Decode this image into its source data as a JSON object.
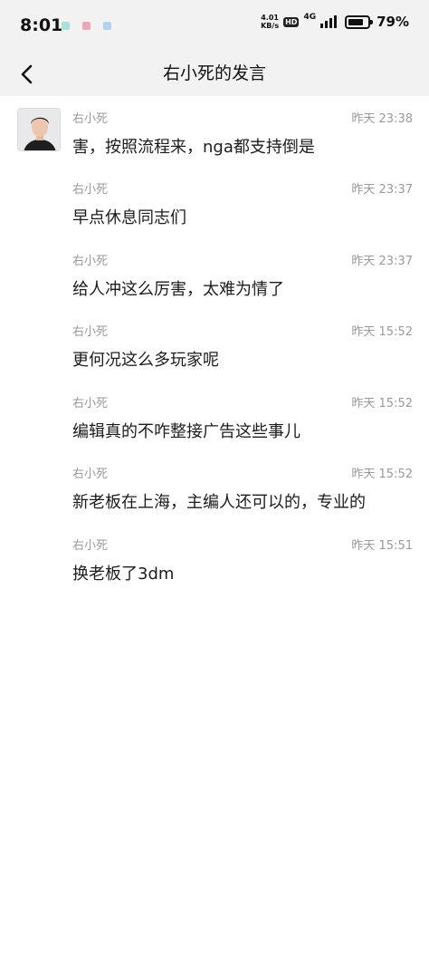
{
  "status_bar": {
    "time": "8:01",
    "net_speed_value": "4.01",
    "net_speed_unit": "KB/s",
    "hd_label": "HD",
    "network_type": "4G",
    "battery_percent": "79%",
    "battery_level": 0.79
  },
  "header": {
    "title": "右小死的发言"
  },
  "posts": [
    {
      "author": "右小死",
      "time": "昨天 23:38",
      "text": "害，按照流程来，nga都支持倒是"
    },
    {
      "author": "右小死",
      "time": "昨天 23:37",
      "text": "早点休息同志们"
    },
    {
      "author": "右小死",
      "time": "昨天 23:37",
      "text": "给人冲这么厉害，太难为情了"
    },
    {
      "author": "右小死",
      "time": "昨天 15:52",
      "text": "更何况这么多玩家呢"
    },
    {
      "author": "右小死",
      "time": "昨天 15:52",
      "text": "编辑真的不咋整接广告这些事儿"
    },
    {
      "author": "右小死",
      "time": "昨天 15:52",
      "text": "新老板在上海，主编人还可以的，专业的"
    },
    {
      "author": "右小死",
      "time": "昨天 15:51",
      "text": "换老板了3dm"
    }
  ],
  "colors": {
    "header_bg": "#f2f2f2",
    "meta_text": "#9a9a9a",
    "body_text": "#1c1c1c"
  }
}
